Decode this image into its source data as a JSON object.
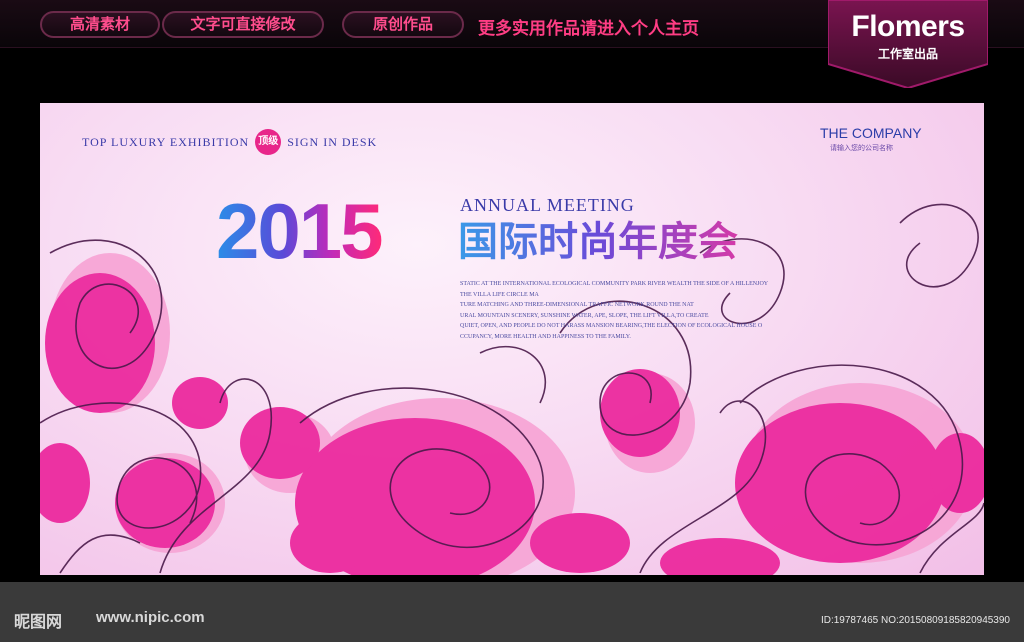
{
  "topbar": {
    "pills": [
      "高清素材",
      "文字可直接修改",
      "原创作品"
    ],
    "slogan": "更多实用作品请进入个人主页"
  },
  "brand": {
    "name": "Flomers",
    "sub": "工作室出品"
  },
  "poster": {
    "tagline_left": "TOP LUXURY EXHIBITION",
    "tagline_badge": "顶级",
    "tagline_right": "SIGN IN DESK",
    "company": "THE COMPANY",
    "company_sub": "请输入您的公司名称",
    "year": "2015",
    "annual": "ANNUAL MEETING",
    "cn_title": "国际时尚年度会",
    "description": [
      "STATIC AT THE INTERNATIONAL ECOLOGICAL COMMUNITY PARK RIVER WEALTH THE SIDE OF A HILLENJOY",
      "THE VILLA LIFE CIRCLE MA",
      "TURE MATCHING AND THREE-DIMENSIONAL TRAFFIC NETWORK,ROUND THE NAT",
      "URAL MOUNTAIN SCENERY, SUNSHINE WATER, APE, SLOPE, THE LIFT VILLA,TO CREATE",
      "QUIET, OPEN, AND PEOPLE DO NOT HARASS MANSION BEARING,THE ELECTION OF ECOLOGICAL HOUSE O",
      "CCUPANCY, MORE HEALTH AND HAPPINESS TO THE FAMILY."
    ],
    "colors": {
      "accent": "#e8268a",
      "blue": "#3a3aa8"
    }
  },
  "footer": {
    "logo": "昵图网",
    "url": "www.nipic.com",
    "id_text": "ID:19787465 NO:20150809185820945390"
  }
}
